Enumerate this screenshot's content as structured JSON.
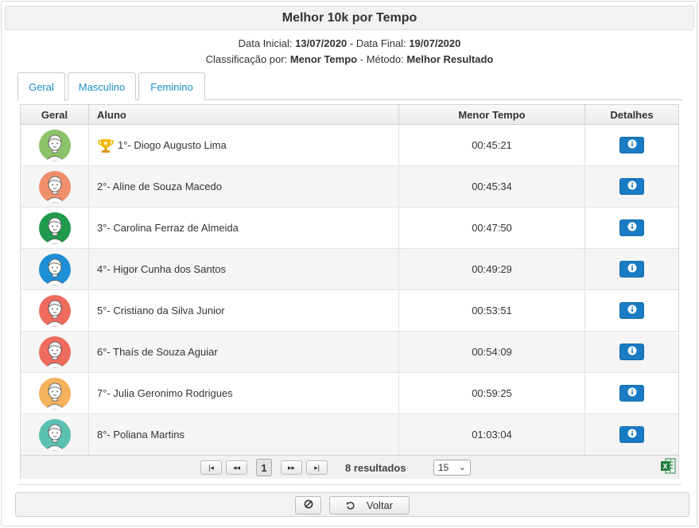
{
  "window": {
    "title": "Melhor 10k por Tempo"
  },
  "info": {
    "data_inicial_label": "Data Inicial:",
    "data_inicial": "13/07/2020",
    "sep": "-",
    "data_final_label": "Data Final:",
    "data_final": "19/07/2020",
    "classificacao_label": "Classificação por:",
    "classificacao": "Menor Tempo",
    "metodo_label": "Método:",
    "metodo": "Melhor Resultado"
  },
  "tabs": [
    {
      "label": "Geral",
      "active": true
    },
    {
      "label": "Masculino",
      "active": false
    },
    {
      "label": "Feminino",
      "active": false
    }
  ],
  "table": {
    "columns": [
      "Geral",
      "Aluno",
      "Menor Tempo",
      "Detalhes"
    ],
    "rows": [
      {
        "aluno": "1°- Diogo Augusto Lima",
        "tempo": "00:45:21",
        "avatar_color": "#8cc26a",
        "trophy": true
      },
      {
        "aluno": "2°- Aline de Souza Macedo",
        "tempo": "00:45:34",
        "avatar_color": "#f08f6b",
        "trophy": false
      },
      {
        "aluno": "3°- Carolina Ferraz de Almeida",
        "tempo": "00:47:50",
        "avatar_color": "#1f9a4d",
        "trophy": false
      },
      {
        "aluno": "4°- Higor Cunha dos Santos",
        "tempo": "00:49:29",
        "avatar_color": "#1e8fd6",
        "trophy": false
      },
      {
        "aluno": "5°- Cristiano da Silva Junior",
        "tempo": "00:53:51",
        "avatar_color": "#ee6b5e",
        "trophy": false
      },
      {
        "aluno": "6°- Thaís de Souza Aguiar",
        "tempo": "00:54:09",
        "avatar_color": "#ee6b5e",
        "trophy": false
      },
      {
        "aluno": "7°- Julia Geronimo Rodrigues",
        "tempo": "00:59:25",
        "avatar_color": "#f5b25c",
        "trophy": false
      },
      {
        "aluno": "8°- Poliana Martins",
        "tempo": "01:03:04",
        "avatar_color": "#5cc0b0",
        "trophy": false
      }
    ]
  },
  "pager": {
    "first": "|◂",
    "prev": "◂◂",
    "page": "1",
    "next": "▸▸",
    "last": "▸|",
    "results": "8 resultados",
    "page_size": "15"
  },
  "footer": {
    "voltar_label": "Voltar"
  },
  "icons": {
    "info": "info-circle-icon",
    "trophy": "trophy-icon",
    "excel": "excel-icon",
    "cancel": "ban-icon",
    "back": "undo-icon"
  },
  "colors": {
    "accent": "#1a7bc4",
    "tab_text": "#1a8ec9",
    "excel_green": "#1e7b3e",
    "trophy_gold": "#f2b705"
  }
}
